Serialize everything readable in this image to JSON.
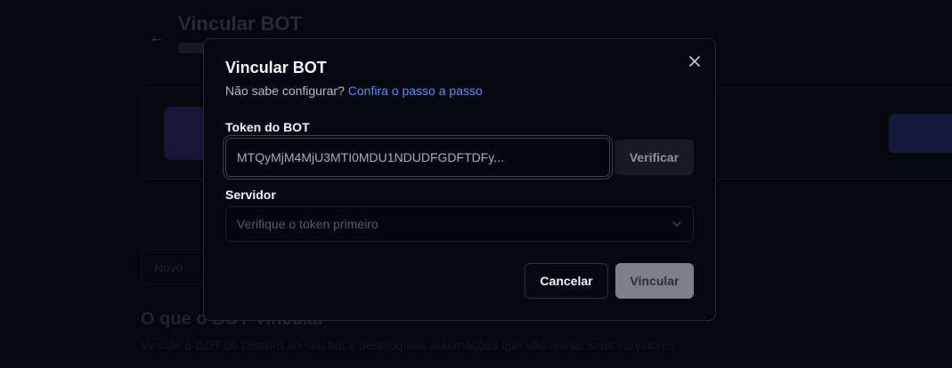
{
  "background": {
    "back_icon": "arrow-left-icon",
    "title": "Vincular BOT",
    "input_text": "Novo",
    "heading": "O que o BOT Vincular",
    "description": "Vincule o BOT do Discord ao seu bot e desbloqueie automações que vão ajudar seus servidores"
  },
  "modal": {
    "title": "Vincular BOT",
    "subtitle_text": "Não sabe configurar?",
    "subtitle_link": "Confira o passo a passo",
    "close_icon": "close-icon",
    "token": {
      "label": "Token do BOT",
      "value": "MTQyMjM4MjU3MTI0MDU1NDUDFGDFTDFy...",
      "verify_label": "Verificar"
    },
    "server": {
      "label": "Servidor",
      "placeholder": "Verifique o token primeiro",
      "chevron_icon": "chevron-down-icon"
    },
    "actions": {
      "cancel_label": "Cancelar",
      "submit_label": "Vincular"
    }
  },
  "colors": {
    "link": "#5b8ff5",
    "modal_bg": "#040712",
    "submit_disabled": "#7e8089"
  }
}
